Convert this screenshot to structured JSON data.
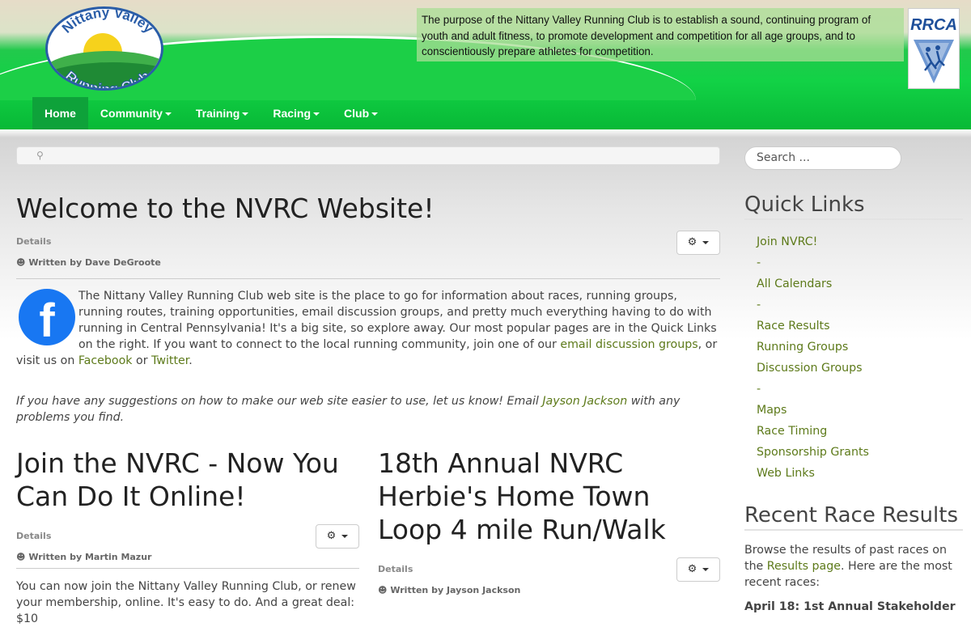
{
  "header": {
    "logo_alt": "Nittany Valley Running Club",
    "logo_line1": "Nittany Valley",
    "logo_line2": "Running Club",
    "purpose": "The purpose of the Nittany Valley Running Club is to establish a sound, continuing program of youth and adult fitness, to promote development and competition for all age groups, and to conscientiously prepare athletes for competition.",
    "rrca_text": "RRCA"
  },
  "nav": [
    {
      "label": "Home",
      "active": true,
      "dropdown": false
    },
    {
      "label": "Community",
      "active": false,
      "dropdown": true
    },
    {
      "label": "Training",
      "active": false,
      "dropdown": true
    },
    {
      "label": "Racing",
      "active": false,
      "dropdown": true
    },
    {
      "label": "Club",
      "active": false,
      "dropdown": true
    }
  ],
  "breadcrumb": {
    "icon": "map-marker-icon"
  },
  "welcome": {
    "title": "Welcome to the NVRC Website!",
    "details_label": "Details",
    "author": "Written by Dave DeGroote",
    "p1_before": "The Nittany Valley Running Club web site is the place to go for information about races, running groups, running routes, training opportunities, email discussion groups, and pretty much everything having to do with running in Central Pennsylvania! It's a big site, so explore away. Our most popular pages are in the Quick Links on the right. If you want to connect to the local running community, join one of our ",
    "link_email_groups": "email discussion groups",
    "p1_mid": ", or visit us on ",
    "link_facebook": "Facebook",
    "p1_or": " or ",
    "link_twitter": "Twitter",
    "p1_end": ".",
    "p2_before": "If you have any suggestions on how to make our web site easier to use, let us know! Email ",
    "link_jayson": "Jayson Jackson",
    "p2_after": " with any problems you find."
  },
  "article_join": {
    "title": "Join the NVRC - Now You Can Do It Online!",
    "details_label": "Details",
    "author": "Written by Martin Mazur",
    "body": "You can now join the Nittany Valley Running Club, or renew your membership, online. It's easy to do. And a great deal: $10"
  },
  "article_herbie": {
    "title": "18th Annual NVRC Herbie's Home Town Loop 4 mile Run/Walk",
    "details_label": "Details",
    "author": "Written by Jayson Jackson"
  },
  "sidebar": {
    "search_placeholder": "Search ...",
    "quick_links_heading": "Quick Links",
    "quick_links": [
      "Join NVRC!",
      "-",
      "All Calendars",
      "-",
      "Race Results",
      "Running Groups",
      "Discussion Groups",
      "-",
      "Maps",
      "Race Timing",
      "Sponsorship Grants",
      "Web Links"
    ],
    "recent_heading": "Recent Race Results",
    "recent_before": "Browse the results of past races on the ",
    "recent_link": "Results page",
    "recent_after": ". Here are the most recent races:",
    "recent_cut": "April 18: 1st Annual Stakeholder"
  },
  "colors": {
    "link": "#5d7a1a",
    "nav_green": "#12d246",
    "nav_active": "#0ea23a"
  }
}
